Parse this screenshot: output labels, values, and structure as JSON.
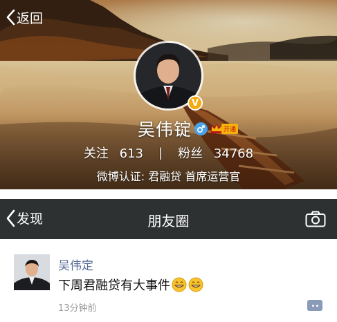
{
  "weibo_header": {
    "back_label": "返回",
    "profile_name": "吴伟锭",
    "vip_tag": "开通",
    "verified_badge": "V",
    "following_label": "关注",
    "following_count": "613",
    "separator": "|",
    "followers_label": "粉丝",
    "followers_count": "34768",
    "verification": "微博认证: 君融贷 首席运营官"
  },
  "wechat_moments": {
    "back_label": "发现",
    "title": "朋友圈",
    "post": {
      "author": "吴伟定",
      "text": "下周君融贷有大事件",
      "time": "13分钟前"
    }
  },
  "colors": {
    "nav_background": "#2e3132",
    "author_link": "#576b95",
    "verified_badge": "#f4a90c",
    "gender_male": "#4aa3ea"
  },
  "icons": [
    "chevron-left-icon",
    "search-icon",
    "more-icon",
    "camera-icon",
    "comment-icon",
    "male-icon",
    "crown-icon",
    "grin-emoji-icon"
  ]
}
